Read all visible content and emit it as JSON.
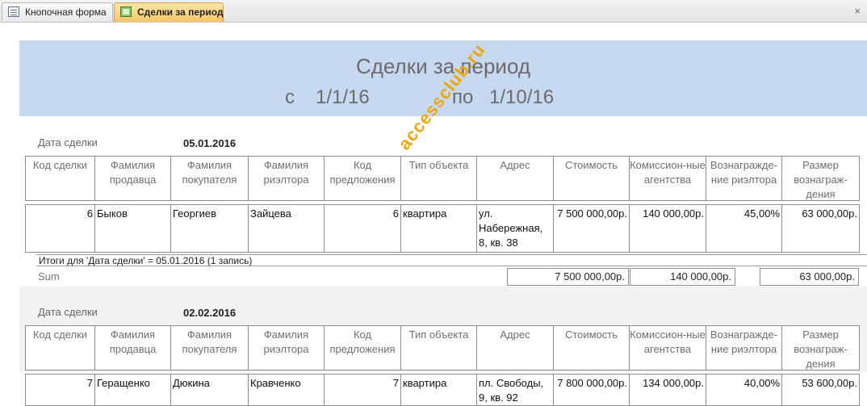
{
  "tabs": [
    {
      "label": "Кнопочная форма",
      "icon": "form-icon"
    },
    {
      "label": "Сделки за период",
      "icon": "report-icon",
      "active": true
    }
  ],
  "close_glyph": "×",
  "report": {
    "title": "Сделки за период",
    "from_label": "с",
    "from_value": "1/1/16",
    "to_label": "по",
    "to_value": "1/10/16"
  },
  "columns": [
    "Код сделки",
    "Фамилия продавца",
    "Фамилия покупателя",
    "Фамилия риэлтора",
    "Код предложения",
    "Тип объекта",
    "Адрес",
    "Стоимость",
    "Комиссион-ные агентства",
    "Вознагражде-ние риэлтора",
    "Размер вознаграж-дения"
  ],
  "groups": [
    {
      "date_label": "Дата сделки",
      "date_value": "05.01.2016",
      "row": {
        "code": "6",
        "seller": "Быков",
        "buyer": "Георгиев",
        "realtor": "Зайцева",
        "offer": "6",
        "type": "квартира",
        "address": "ул. Набережная, 8, кв. 38",
        "cost": "7 500 000,00р.",
        "commission": "140 000,00р.",
        "reward_pct": "45,00%",
        "reward": "63 000,00р."
      },
      "totals_text": "Итоги для 'Дата сделки' =  05.01.2016 (1 запись)",
      "sum_label": "Sum",
      "sum_cost": "7 500 000,00р.",
      "sum_commission": "140 000,00р.",
      "sum_reward": "63 000,00р."
    },
    {
      "date_label": "Дата сделки",
      "date_value": "02.02.2016",
      "row": {
        "code": "7",
        "seller": "Геращенко",
        "buyer": "Дюкина",
        "realtor": "Кравченко",
        "offer": "7",
        "type": "квартира",
        "address": "пл. Свободы, 9, кв. 92",
        "cost": "7 800 000,00р.",
        "commission": "134 000,00р.",
        "reward_pct": "40,00%",
        "reward": "53 600,00р."
      }
    }
  ],
  "watermark": "accessclub.ru"
}
